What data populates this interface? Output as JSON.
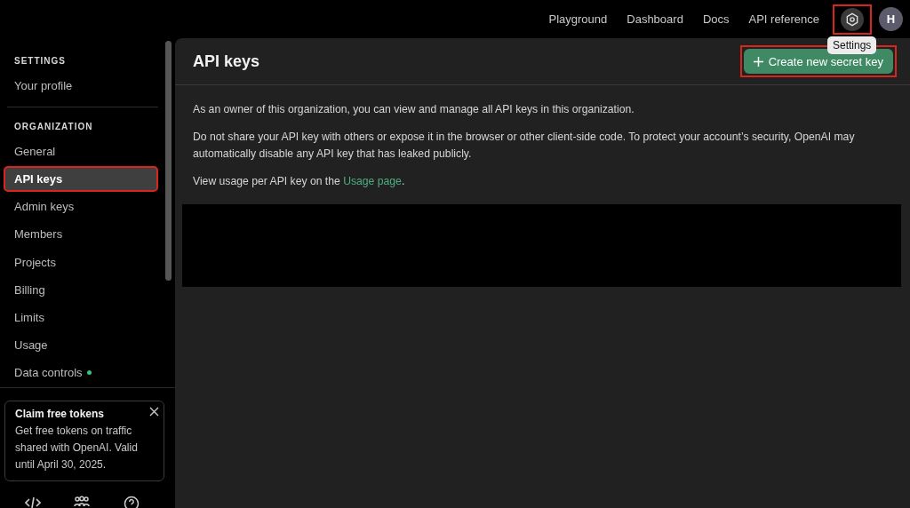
{
  "topbar": {
    "links": [
      "Playground",
      "Dashboard",
      "Docs",
      "API reference"
    ],
    "settings": {
      "tooltip": "Settings",
      "highlighted": true
    },
    "avatar": "H"
  },
  "sidebar": {
    "sections": [
      {
        "heading": "SETTINGS",
        "items": [
          {
            "label": "Your profile",
            "selected": false,
            "highlighted": false
          }
        ]
      },
      {
        "heading": "ORGANIZATION",
        "items": [
          {
            "label": "General",
            "selected": false,
            "highlighted": false
          },
          {
            "label": "API keys",
            "selected": true,
            "highlighted": true
          },
          {
            "label": "Admin keys",
            "selected": false,
            "highlighted": false
          },
          {
            "label": "Members",
            "selected": false,
            "highlighted": false
          },
          {
            "label": "Projects",
            "selected": false,
            "highlighted": false
          },
          {
            "label": "Billing",
            "selected": false,
            "highlighted": false
          },
          {
            "label": "Limits",
            "selected": false,
            "highlighted": false
          },
          {
            "label": "Usage",
            "selected": false,
            "highlighted": false
          },
          {
            "label": "Data controls",
            "selected": false,
            "highlighted": false,
            "color": "#3fbf7f"
          }
        ]
      }
    ],
    "promo": {
      "title": "Claim free tokens",
      "body": "Get free tokens on traffic shared with OpenAI. Valid until April 30, 2025."
    },
    "footer_buttons": [
      {
        "kind": "code"
      },
      {
        "kind": "team"
      },
      {
        "kind": "help"
      }
    ]
  },
  "main": {
    "title": "API keys",
    "create_button": {
      "label": "Create new secret key",
      "highlighted": true
    },
    "paragraphs": [
      "As an owner of this organization, you can view and manage all API keys in this organization.",
      "Do not share your API key with others or expose it in the browser or other client-side code. To protect your account’s security, OpenAI may automatically disable any API key that has leaked publicly."
    ],
    "usage_note": {
      "before": "View usage per API key on the ",
      "link": "Usage page",
      "after": "."
    }
  }
}
